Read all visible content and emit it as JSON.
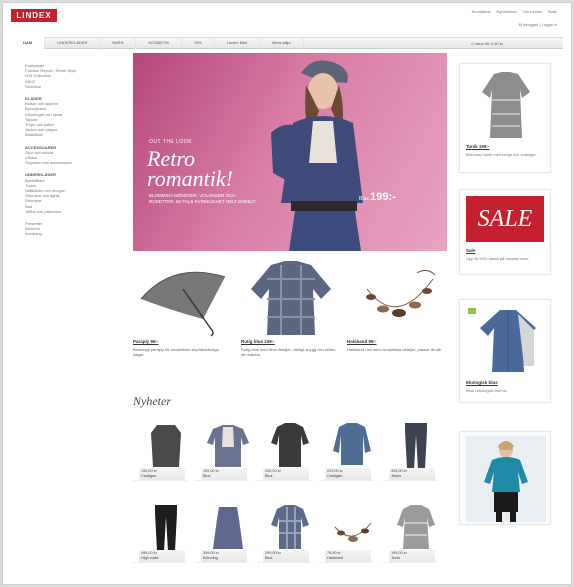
{
  "header": {
    "logo": "LINDEX",
    "top_links": [
      "Kundtjänst",
      "Nyhetsbrev",
      "Om Lindex",
      "Butik"
    ],
    "account": "Ej inloggad | Logga in"
  },
  "nav": {
    "tabs": [
      "DAM",
      "UNDERKLÄDER",
      "BARN",
      "KOSMETIK",
      "SPA",
      "Lindex Mini",
      "Mera sälja"
    ],
    "cart": "0 varor för 0,00 kr"
  },
  "sidebar": {
    "groups": [
      {
        "head": "",
        "items": [
          "Kampanjer",
          "Fashion Report / Street Style",
          "H15 Collection",
          "SALE",
          "Storlekar"
        ]
      },
      {
        "head": "KLÄDER",
        "items": [
          "Blusar och skjortor",
          "Byxor/jeans",
          "Klänningar och kjolar",
          "Toppar",
          "Tröjor och koftor",
          "Jackor och kappor",
          "Badkläder"
        ]
      },
      {
        "head": "ACCESSOARER",
        "items": [
          "Skor och stövlar",
          "Väskor",
          "Smycken och accessoarer"
        ]
      },
      {
        "head": "UNDERKLÄDER",
        "items": [
          "Bysthållare",
          "Trosor",
          "Nattkläder och morgon",
          "Strumpor och tights",
          "Strumpor",
          "Bad",
          "Tofflor och pälsskinn"
        ]
      },
      {
        "head": "",
        "items": [
          "Presenter",
          "Skönhet",
          "Inredning"
        ]
      }
    ]
  },
  "hero": {
    "ootd": "OUT THE LOOK",
    "title_line1": "Retro",
    "title_line2": "romantik!",
    "sub": "BLOMMIGA MÖNSTER, VOLANGER OCH ROSETTER. 50-TALS KVINNLIGHET HELT ENKELT.",
    "price_prefix": "Blus ",
    "price": "199:-"
  },
  "products": [
    {
      "name": "Paraply 99:-",
      "desc": "Blommigt paraply för romantiska skyddsmässiga dagar."
    },
    {
      "name": "Rutig blus 249:-",
      "desc": "Rutig blus med flera detaljer, väldigt snygg och stilren att matcha."
    },
    {
      "name": "Halsband 99:-",
      "desc": "Halsband i trä med romantiska detaljer, passar till allt."
    }
  ],
  "nyheter_title": "Nyheter",
  "tiles_row1": [
    {
      "price": "199,00 kr",
      "name": "Cardigan"
    },
    {
      "price": "199,00 kr",
      "name": "Blus"
    },
    {
      "price": "249,00 kr",
      "name": "Blus"
    },
    {
      "price": "229,00 kr",
      "name": "Cardigan"
    },
    {
      "price": "499,00 kr",
      "name": "Jeans"
    }
  ],
  "tiles_row2": [
    {
      "price": "499,00 kr",
      "name": "High waist"
    },
    {
      "price": "399,00 kr",
      "name": "Klänning"
    },
    {
      "price": "299,00 kr",
      "name": "Blus"
    },
    {
      "price": "79,90 kr",
      "name": "Halsband"
    },
    {
      "price": "199,00 kr",
      "name": "Tunik"
    }
  ],
  "right": {
    "box1": {
      "name": "Tunik 199:-",
      "desc": "Mönstrad tunik med kedja och volanger."
    },
    "box2": {
      "sale": "SALE",
      "name": "Sale",
      "desc": "Upp till 50% rabatt på utvalda varor."
    },
    "box3": {
      "name": "Ekologisk blus",
      "desc": "Blus i ekologisk bomull."
    }
  },
  "colors": {
    "brand": "#c4202e",
    "hero": "#d87da6",
    "denim": "#4a6a9a"
  }
}
